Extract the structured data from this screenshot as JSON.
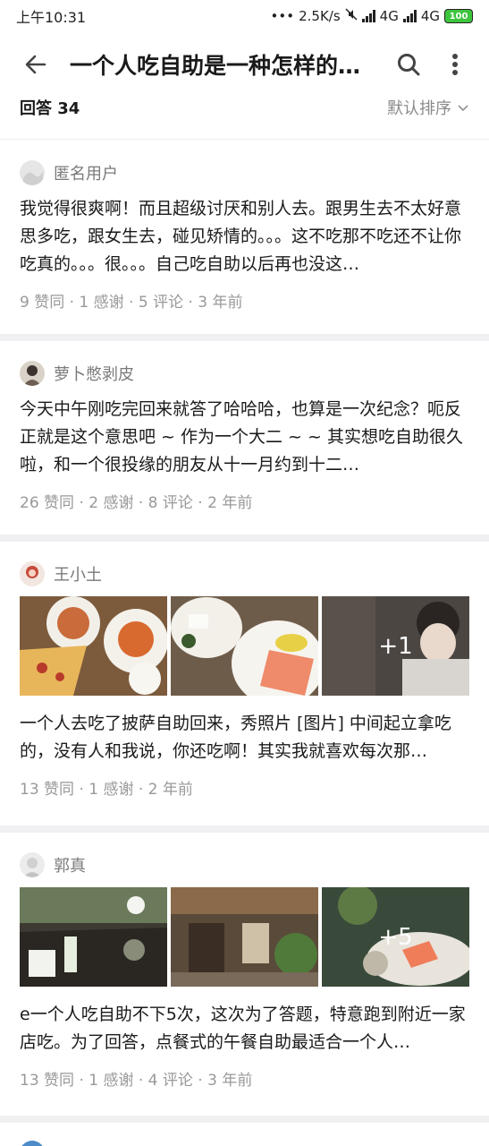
{
  "status": {
    "time": "上午10:31",
    "speed": "2.5K/s",
    "net1": "4G",
    "net2": "4G",
    "battery": "100"
  },
  "topbar": {
    "title": "一个人吃自助是一种怎样的体验？"
  },
  "answers": {
    "count_label": "回答 34",
    "sort_label": "默认排序"
  },
  "cards": [
    {
      "author": "匿名用户",
      "excerpt": "我觉得很爽啊！而且超级讨厌和别人去。跟男生去不太好意思多吃，跟女生去，碰见矫情的。。。这不吃那不吃还不让你吃真的。。。很。。。自己吃自助以后再也没这…",
      "meta": "9 赞同 · 1 感谢 · 5 评论 · 3 年前"
    },
    {
      "author": "萝卜憋剥皮",
      "excerpt": "今天中午刚吃完回来就答了哈哈哈，也算是一次纪念？呃反正就是这个意思吧 ~ 作为一个大二 ~ ~ 其实想吃自助很久啦，和一个很投缘的朋友从十一月约到十二…",
      "meta": "26 赞同 · 2 感谢 · 8 评论 · 2 年前"
    },
    {
      "author": "王小土",
      "more_images": "+1",
      "excerpt": "一个人去吃了披萨自助回来，秀照片 [图片] 中间起立拿吃的，没有人和我说，你还吃啊！其实我就喜欢每次那…",
      "meta": "13 赞同 · 1 感谢 · 2 年前"
    },
    {
      "author": "郭真",
      "more_images": "+5",
      "excerpt": "e一个人吃自助不下5次，这次为了答题，特意跑到附近一家店吃。为了回答，点餐式的午餐自助最适合一个人…",
      "meta": "13 赞同 · 1 感谢 · 4 评论 · 3 年前"
    }
  ]
}
